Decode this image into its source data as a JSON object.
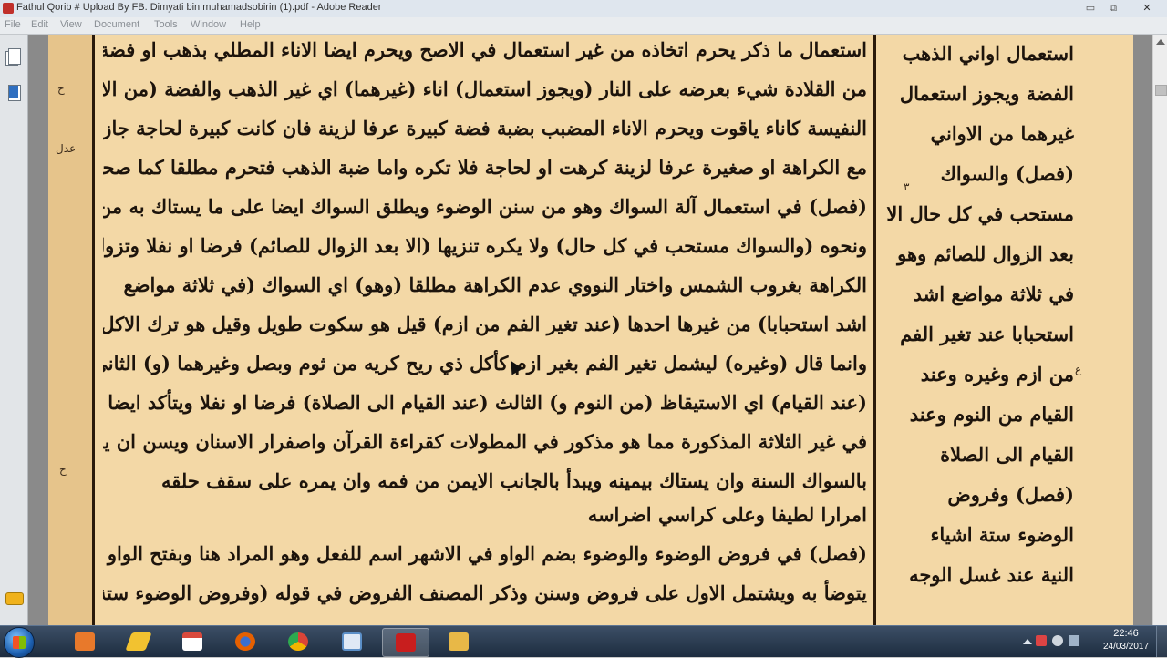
{
  "window": {
    "title": "Fathul Qorib # Upload By FB. Dimyati bin muhamadsobirin (1).pdf - Adobe Reader",
    "minimize": "▭",
    "maximize": "⧉",
    "close": "✕"
  },
  "menu": [
    "File",
    "Edit",
    "View",
    "Document",
    "Tools",
    "Window",
    "Help"
  ],
  "nav_icons": [
    "pages-icon",
    "bookmarks-icon",
    "comment-icon"
  ],
  "document": {
    "main_lines": [
      "استعمال ما ذكر يحرم اتخاذه من غير استعمال في الاصح ويحرم ايضا الاناء المطلي بذهب او فضة ان حصل",
      "من القلادة شيء بعرضه على النار (ويجوز استعمال) اناء (غيرهما) اي غير الذهب والفضة (من الاواني)",
      "النفيسة كاناء ياقوت ويحرم الاناء المضبب بضبة فضة كبيرة عرفا لزينة فان كانت كبيرة لحاجة جاز",
      "مع الكراهة او صغيرة عرفا لزينة كرهت او لحاجة فلا تكره واما ضبة الذهب فتحرم مطلقا كما صححه النووي",
      "(فصل) في استعمال آلة السواك وهو من سنن الوضوء ويطلق السواك ايضا على ما يستاك به من اراك",
      "ونحوه (والسواك مستحب في كل حال) ولا يكره تنزيها (الا بعد الزوال للصائم) فرضا او نفلا وتزول",
      "الكراهة بغروب الشمس واختار النووي عدم الكراهة مطلقا (وهو) اي السواك (في ثلاثة مواضع",
      "اشد استحبابا) من غيرها احدها (عند تغير الفم من ازم) قيل هو سكوت طويل وقيل هو ترك الاكل",
      "وانما قال (وغيره) ليشمل تغير الفم بغير ازم كأكل ذي ريح كريه من ثوم وبصل وغيرهما (و) الثاني",
      "(عند القيام) اي الاستيقاظ (من النوم و) الثالث (عند القيام الى الصلاة) فرضا او نفلا ويتأكد ايضا",
      "في غير الثلاثة المذكورة مما هو مذكور في المطولات كقراءة القرآن واصفرار الاسنان ويسن ان ينوي",
      "بالسواك السنة وان يستاك بيمينه ويبدأ بالجانب الايمن من فمه وان يمره على سقف حلقه",
      "امرارا لطيفا وعلى كراسي اضراسه",
      "(فصل) في فروض الوضوء والوضوء بضم الواو في الاشهر اسم للفعل وهو المراد هنا وبفتح الواو اسم لما",
      "يتوضأ به ويشتمل الاول على فروض وسنن وذكر المصنف الفروض في قوله (وفروض الوضوء ستة اشياء"
    ],
    "side_lines": [
      "استعمال اواني الذهب",
      "الفضة ويجوز استعمال",
      "غيرهما من الاواني",
      "(فصل) والسواك",
      "مستحب في كل حال الا",
      "بعد الزوال للصائم وهو",
      "في ثلاثة مواضع اشد",
      "استحبابا عند تغير الفم",
      "من ازم وغيره وعند",
      "القيام من النوم وعند",
      "القيام الى الصلاة",
      "(فصل) وفروض",
      "الوضوء ستة اشياء",
      "النية عند غسل الوجه"
    ],
    "margin_marks": [
      "ح",
      "عدل",
      "٣",
      "ح",
      "ع"
    ]
  },
  "taskbar": {
    "buttons": [
      {
        "name": "windows-media-button",
        "color": "#e8792b"
      },
      {
        "name": "pen-tool-button",
        "color": "#f2c230"
      },
      {
        "name": "calendar-app-button",
        "color": "#d94a3d"
      },
      {
        "name": "firefox-button",
        "color": "#e66000"
      },
      {
        "name": "chrome-button",
        "color": "#2da94f"
      },
      {
        "name": "window-app-button",
        "color": "#5b8fc7"
      },
      {
        "name": "adobe-reader-button",
        "color": "#c81e1e"
      },
      {
        "name": "file-explorer-button",
        "color": "#e8b847"
      }
    ],
    "clock_time": "22:46",
    "clock_date": "24/03/2017"
  }
}
